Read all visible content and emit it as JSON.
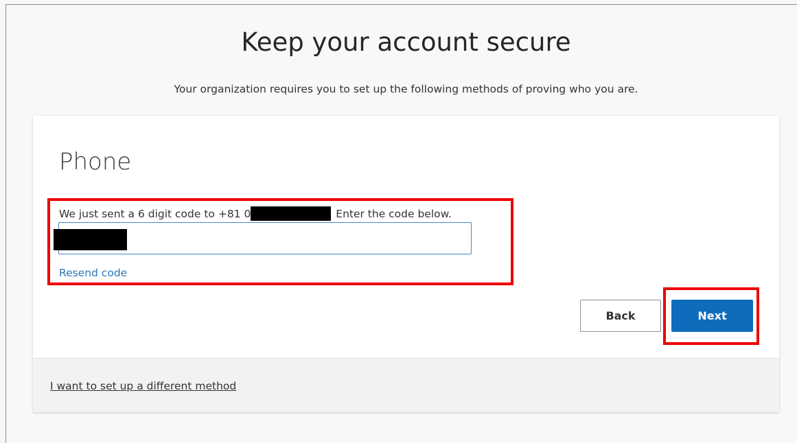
{
  "header": {
    "title": "Keep your account secure",
    "subtitle": "Your organization requires you to set up the following methods of proving who you are."
  },
  "method": {
    "title": "Phone",
    "instruction_prefix": "We just sent a 6 digit code to +81 0",
    "instruction_suffix": " Enter the code below.",
    "code_placeholder": "",
    "resend_label": "Resend code"
  },
  "actions": {
    "back_label": "Back",
    "next_label": "Next"
  },
  "footer": {
    "alt_method_label": "I want to set up a different method"
  },
  "colors": {
    "primary": "#0f6cbd",
    "link": "#2b77b8",
    "annotation": "#ee0000"
  }
}
